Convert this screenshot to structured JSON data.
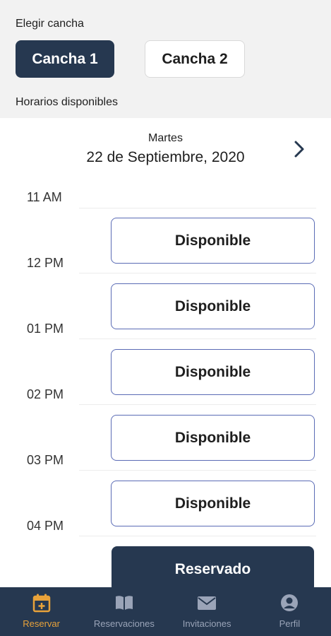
{
  "header": {
    "choose_court_label": "Elegir cancha",
    "available_hours_label": "Horarios disponibles",
    "courts": [
      {
        "label": "Cancha 1",
        "selected": true
      },
      {
        "label": "Cancha 2",
        "selected": false
      }
    ]
  },
  "schedule": {
    "day_name": "Martes",
    "date": "22 de Septiembre, 2020",
    "next_icon": "chevron-right-icon",
    "times": [
      "11 AM",
      "12 PM",
      "01 PM",
      "02 PM",
      "03 PM",
      "04 PM"
    ],
    "slots": [
      {
        "label": "Disponible",
        "status": "available"
      },
      {
        "label": "Disponible",
        "status": "available"
      },
      {
        "label": "Disponible",
        "status": "available"
      },
      {
        "label": "Disponible",
        "status": "available"
      },
      {
        "label": "Disponible",
        "status": "available"
      },
      {
        "label": "Reservado",
        "status": "reserved"
      }
    ]
  },
  "bottom_nav": {
    "items": [
      {
        "label": "Reservar",
        "icon": "calendar-plus-icon",
        "active": true
      },
      {
        "label": "Reservaciones",
        "icon": "book-icon",
        "active": false
      },
      {
        "label": "Invitaciones",
        "icon": "envelope-icon",
        "active": false
      },
      {
        "label": "Perfil",
        "icon": "user-circle-icon",
        "active": false
      }
    ]
  },
  "colors": {
    "primary": "#263850",
    "accent": "#e8a23a",
    "slot_border": "#5a6bb5",
    "nav_inactive": "#9aa4b8",
    "top_background": "#f2f2f2"
  }
}
